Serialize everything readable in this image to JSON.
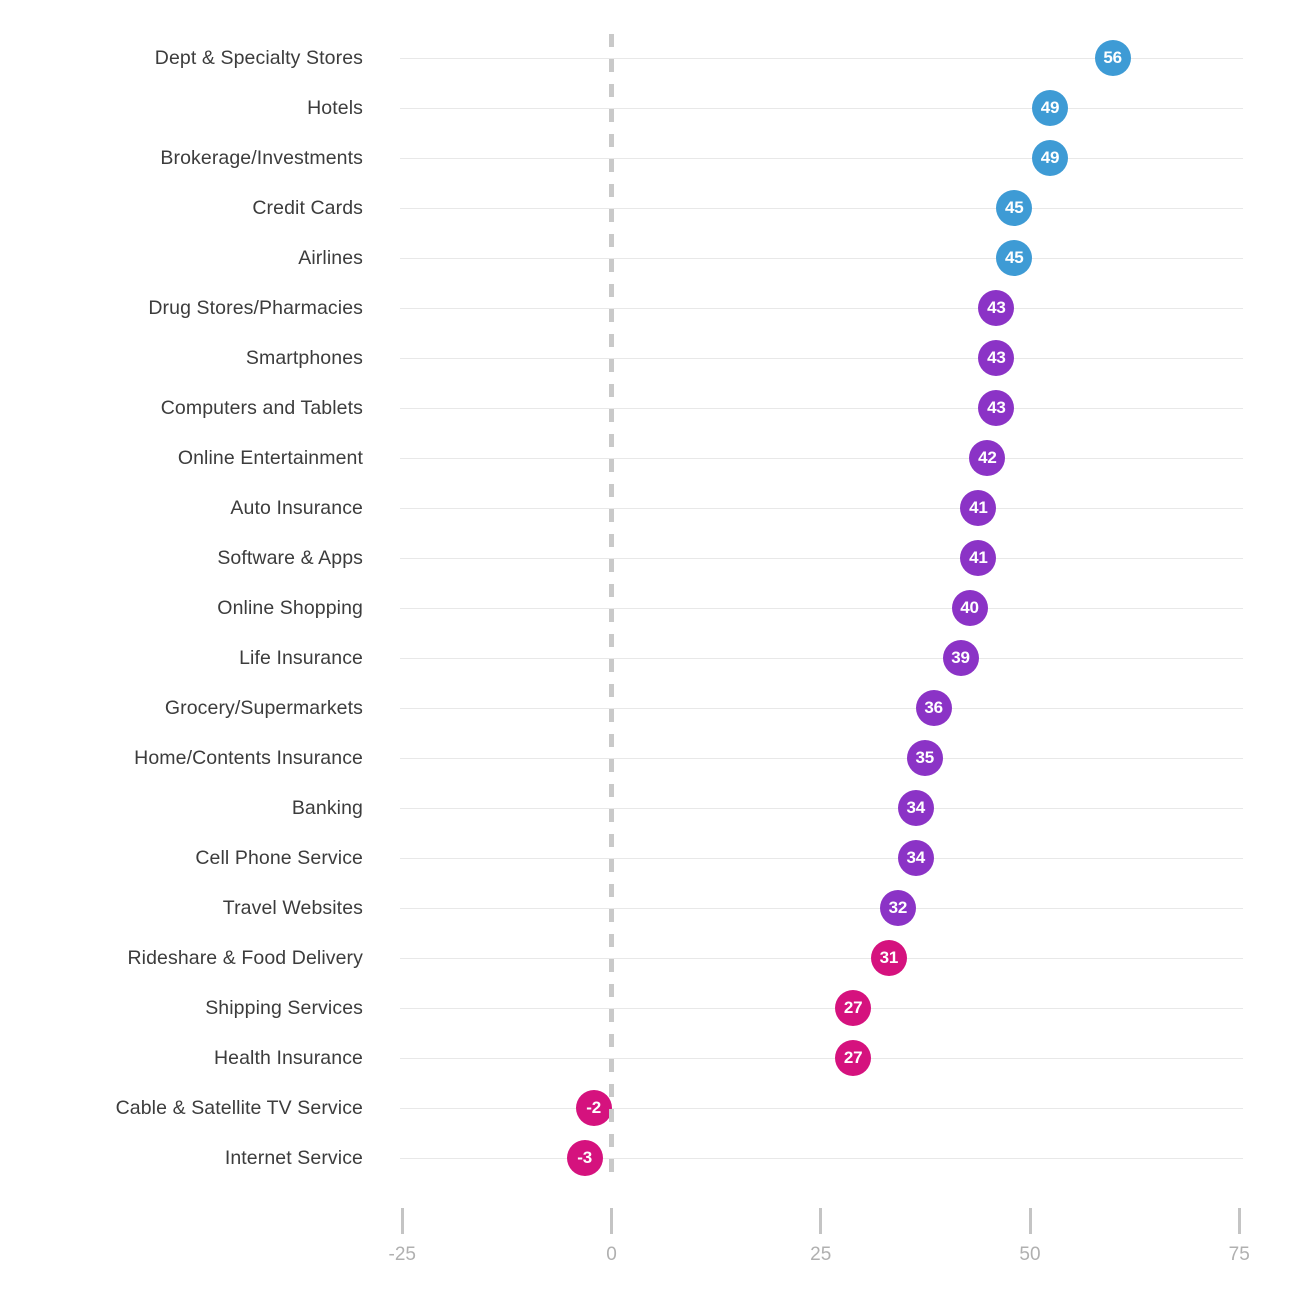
{
  "chart_data": {
    "type": "scatter",
    "orientation": "horizontal",
    "title": "",
    "subtitle": "",
    "xlabel": "",
    "ylabel": "",
    "xlim": [
      -33,
      78
    ],
    "xticks": [
      -25,
      0,
      25,
      50,
      75
    ],
    "xtick_labels": [
      "-25",
      "0",
      "25",
      "50",
      "75"
    ],
    "grid": "horizontal",
    "legend": "none",
    "zero_reference_line": 0,
    "categories": [
      "Dept & Specialty Stores",
      "Hotels",
      "Brokerage/Investments",
      "Credit Cards",
      "Airlines",
      "Drug Stores/Pharmacies",
      "Smartphones",
      "Computers and Tablets",
      "Online Entertainment",
      "Auto Insurance",
      "Software & Apps",
      "Online Shopping",
      "Life Insurance",
      "Grocery/Supermarkets",
      "Home/Contents Insurance",
      "Banking",
      "Cell Phone Service",
      "Travel Websites",
      "Rideshare & Food Delivery",
      "Shipping Services",
      "Health Insurance",
      "Cable & Satellite TV Service",
      "Internet Service"
    ],
    "values": [
      56,
      49,
      49,
      45,
      45,
      43,
      43,
      43,
      42,
      41,
      41,
      40,
      39,
      36,
      35,
      34,
      34,
      32,
      31,
      27,
      27,
      -2,
      -3
    ],
    "point_labels": [
      "56",
      "49",
      "49",
      "45",
      "45",
      "43",
      "43",
      "43",
      "42",
      "41",
      "41",
      "40",
      "39",
      "36",
      "35",
      "34",
      "34",
      "32",
      "31",
      "27",
      "27",
      "-2",
      "-3"
    ],
    "point_colors": [
      "#3e9bd5",
      "#3e9bd5",
      "#3e9bd5",
      "#3e9bd5",
      "#3e9bd5",
      "#8b33c6",
      "#8b33c6",
      "#8b33c6",
      "#8b33c6",
      "#8b33c6",
      "#8b33c6",
      "#8b33c6",
      "#8b33c6",
      "#8b33c6",
      "#8b33c6",
      "#8b33c6",
      "#8b33c6",
      "#8b33c6",
      "#d5127e",
      "#d5127e",
      "#d5127e",
      "#d5127e",
      "#d5127e"
    ],
    "colors": {
      "blue": "#3e9bd5",
      "purple": "#8b33c6",
      "magenta": "#d5127e",
      "gridline": "#e8e8e8",
      "zero_line": "#c9c9c9",
      "tick": "#c4c4c4",
      "tick_label": "#b0b0b0",
      "category_label": "#3c3c3c",
      "background": "#ffffff"
    }
  }
}
